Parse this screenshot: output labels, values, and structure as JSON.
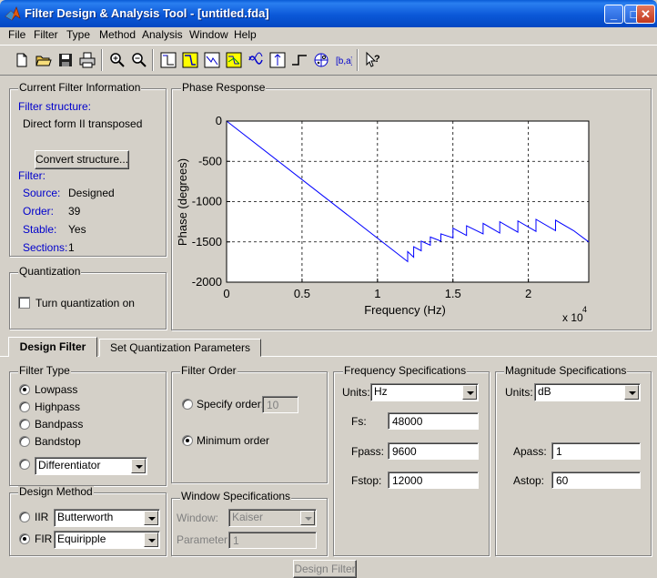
{
  "window": {
    "title": "Filter Design & Analysis Tool - [untitled.fda]",
    "minimize": "_",
    "maximize": "□",
    "close": "✕"
  },
  "menu": [
    "File",
    "Filter",
    "Type",
    "Method",
    "Analysis",
    "Window",
    "Help"
  ],
  "toolbar": {
    "icons": [
      "new-file-icon",
      "open-folder-icon",
      "save-icon",
      "print-icon",
      "zoom-in-icon",
      "zoom-out-icon",
      "filter-specs-icon",
      "magnitude-response-icon",
      "phase-response-icon",
      "magnitude-phase-icon",
      "group-delay-icon",
      "impulse-response-icon",
      "step-response-icon",
      "pole-zero-icon",
      "coefficients-icon",
      "whats-this-icon"
    ]
  },
  "current_filter": {
    "legend": "Current Filter Information",
    "structure_label": "Filter structure:",
    "structure_value": "Direct form II transposed",
    "convert_button": "Convert structure...",
    "filter_label": "Filter:",
    "source_label": "Source:",
    "source_value": "Designed",
    "order_label": "Order:",
    "order_value": "39",
    "stable_label": "Stable:",
    "stable_value": "Yes",
    "sections_label": "Sections:",
    "sections_value": "1"
  },
  "quantization": {
    "legend": "Quantization",
    "checkbox_label": "Turn quantization on",
    "checked": false
  },
  "plot": {
    "legend": "Phase Response",
    "line_color": "#0000ff"
  },
  "chart_data": {
    "type": "line",
    "title": "",
    "xlabel": "Frequency (Hz)",
    "ylabel": "Phase (degrees)",
    "x_exponent_label": "x 10",
    "x_exponent": "4",
    "xlim": [
      0,
      24000
    ],
    "ylim": [
      -2000,
      0
    ],
    "xticks": [
      0,
      5000,
      10000,
      15000,
      20000
    ],
    "xtick_labels": [
      "0",
      "0.5",
      "1",
      "1.5",
      "2"
    ],
    "yticks": [
      0,
      -500,
      -1000,
      -1500,
      -2000
    ],
    "ytick_labels": [
      "0",
      "-500",
      "-1000",
      "-1500",
      "-2000"
    ],
    "grid": true,
    "series": [
      {
        "x": [
          0,
          12000,
          12000,
          12400,
          12400,
          12900,
          12900,
          13500,
          13500,
          14200,
          14200,
          15000,
          15000,
          15900,
          15900,
          17000,
          17000,
          18100,
          18100,
          19300,
          19300,
          20500,
          20500,
          21800,
          21800,
          23000,
          24000
        ],
        "y": [
          0,
          -1745,
          -1620,
          -1690,
          -1560,
          -1610,
          -1490,
          -1540,
          -1440,
          -1490,
          -1400,
          -1450,
          -1330,
          -1420,
          -1300,
          -1400,
          -1270,
          -1390,
          -1250,
          -1380,
          -1240,
          -1370,
          -1220,
          -1360,
          -1230,
          -1360,
          -1500
        ]
      }
    ]
  },
  "tabs": {
    "design": "Design Filter",
    "quantization": "Set Quantization Parameters"
  },
  "filter_type": {
    "legend": "Filter Type",
    "options": [
      "Lowpass",
      "Highpass",
      "Bandpass",
      "Bandstop"
    ],
    "selected": "Lowpass",
    "other_value": "Differentiator"
  },
  "design_method": {
    "legend": "Design Method",
    "iir_label": "IIR",
    "iir_value": "Butterworth",
    "fir_label": "FIR",
    "fir_value": "Equiripple",
    "selected": "FIR"
  },
  "filter_order": {
    "legend": "Filter Order",
    "specify_label": "Specify order:",
    "specify_value": "10",
    "minimum_label": "Minimum order",
    "selected": "Minimum order"
  },
  "window_specs": {
    "legend": "Window Specifications",
    "window_label": "Window:",
    "window_value": "Kaiser",
    "parameter_label": "Parameter:",
    "parameter_value": "1"
  },
  "frequency_specs": {
    "legend": "Frequency Specifications",
    "units_label": "Units:",
    "units_value": "Hz",
    "fs_label": "Fs:",
    "fs_value": "48000",
    "fpass_label": "Fpass:",
    "fpass_value": "9600",
    "fstop_label": "Fstop:",
    "fstop_value": "12000"
  },
  "magnitude_specs": {
    "legend": "Magnitude Specifications",
    "units_label": "Units:",
    "units_value": "dB",
    "apass_label": "Apass:",
    "apass_value": "1",
    "astop_label": "Astop:",
    "astop_value": "60"
  },
  "design_button": "Design Filter"
}
